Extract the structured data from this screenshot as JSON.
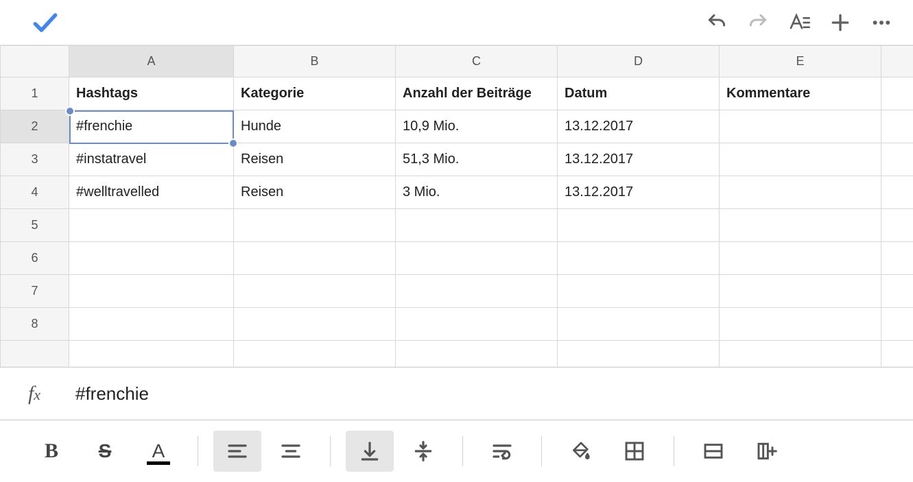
{
  "toolbar_top": {
    "confirm": "Confirm",
    "undo": "Undo",
    "redo": "Redo",
    "text_format": "Text format",
    "insert": "Insert",
    "more": "More"
  },
  "columns": [
    "A",
    "B",
    "C",
    "D",
    "E"
  ],
  "row_numbers": [
    "1",
    "2",
    "3",
    "4",
    "5",
    "6",
    "7",
    "8"
  ],
  "headers": {
    "A": "Hashtags",
    "B": "Kategorie",
    "C": "Anzahl der Beiträge",
    "D": "Datum",
    "E": "Kommentare"
  },
  "rows": [
    {
      "A": "#frenchie",
      "B": "Hunde",
      "C": "10,9 Mio.",
      "D": "13.12.2017",
      "E": ""
    },
    {
      "A": "#instatravel",
      "B": "Reisen",
      "C": "51,3 Mio.",
      "D": "13.12.2017",
      "E": ""
    },
    {
      "A": "#welltravelled",
      "B": "Reisen",
      "C": "3 Mio.",
      "D": "13.12.2017",
      "E": ""
    }
  ],
  "selection": {
    "cell": "A2",
    "value": "#frenchie"
  },
  "formula_bar": {
    "label": "fx",
    "value": "#frenchie"
  },
  "toolbar_bottom": {
    "bold": "B",
    "strike": "S",
    "text_color": "A",
    "align_left": "Align left",
    "align_center": "Align center",
    "valign_bottom": "Vertical align bottom",
    "valign_middle": "Vertical align middle",
    "wrap": "Text wrapping",
    "fill_color": "Fill color",
    "borders": "Borders",
    "merge": "Merge cells",
    "insert_col": "Insert column"
  }
}
